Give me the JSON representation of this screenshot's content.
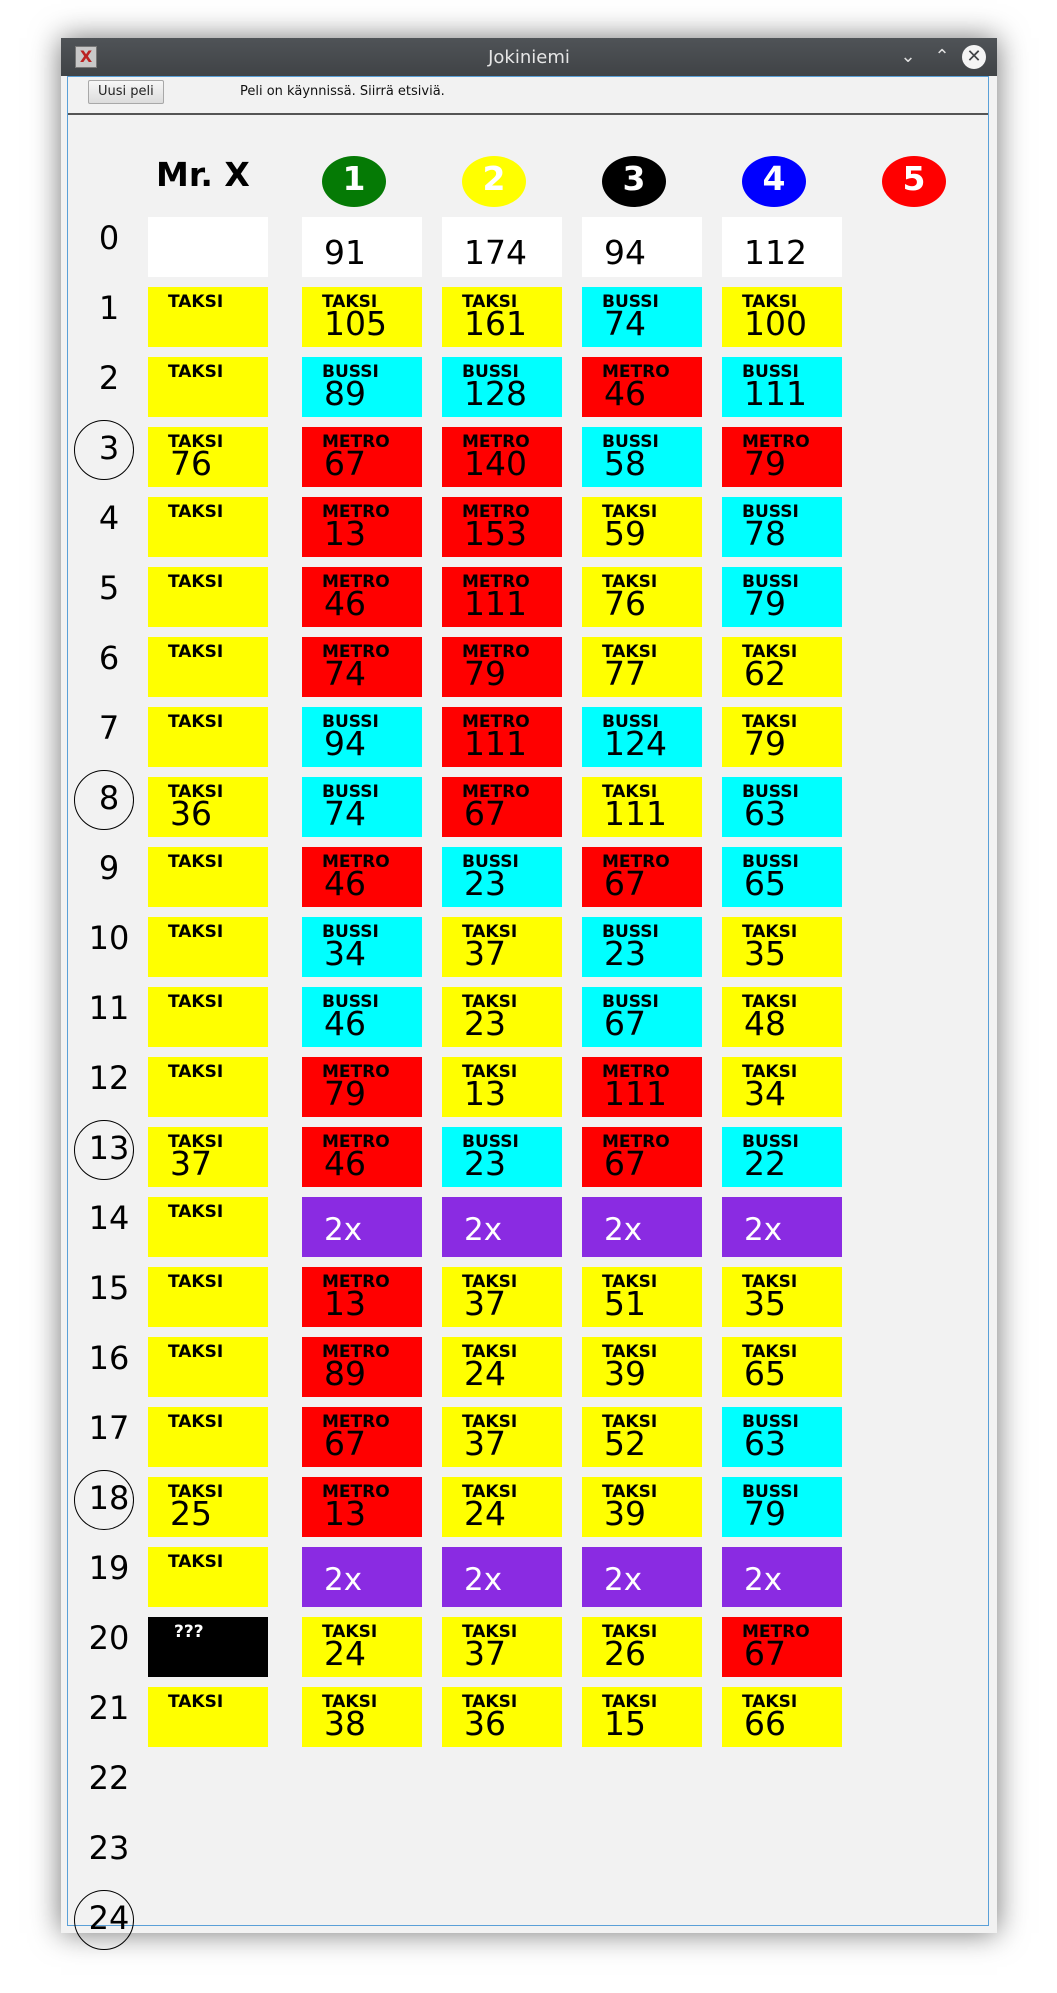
{
  "window": {
    "title": "Jokiniemi"
  },
  "toolbar": {
    "new_game_label": "Uusi peli",
    "status_text": "Peli on käynnissä. Siirrä etsiviä."
  },
  "mrx_title": "Mr. X",
  "detectives": [
    {
      "label": "1",
      "color": "#057a05"
    },
    {
      "label": "2",
      "color": "#ffff00"
    },
    {
      "label": "3",
      "color": "#000000"
    },
    {
      "label": "4",
      "color": "#0000ff"
    },
    {
      "label": "5",
      "color": "#ff0000"
    }
  ],
  "colors": {
    "TAKSI": "#ffff00",
    "BUSSI": "#00ffff",
    "METRO": "#ff0000",
    "double": "#8a2be2",
    "hidden": "#000000",
    "empty": "#ffffff"
  },
  "reveal_rounds": [
    3,
    8,
    13,
    18,
    24
  ],
  "rounds": [
    "0",
    "1",
    "2",
    "3",
    "4",
    "5",
    "6",
    "7",
    "8",
    "9",
    "10",
    "11",
    "12",
    "13",
    "14",
    "15",
    "16",
    "17",
    "18",
    "19",
    "20",
    "21",
    "22",
    "23",
    "24"
  ],
  "mrx_moves": [
    {
      "kind": "empty"
    },
    {
      "kind": "ticket",
      "ticket": "TAKSI"
    },
    {
      "kind": "ticket",
      "ticket": "TAKSI"
    },
    {
      "kind": "ticket",
      "ticket": "TAKSI",
      "loc": "76"
    },
    {
      "kind": "ticket",
      "ticket": "TAKSI"
    },
    {
      "kind": "ticket",
      "ticket": "TAKSI"
    },
    {
      "kind": "ticket",
      "ticket": "TAKSI"
    },
    {
      "kind": "ticket",
      "ticket": "TAKSI"
    },
    {
      "kind": "ticket",
      "ticket": "TAKSI",
      "loc": "36"
    },
    {
      "kind": "ticket",
      "ticket": "TAKSI"
    },
    {
      "kind": "ticket",
      "ticket": "TAKSI"
    },
    {
      "kind": "ticket",
      "ticket": "TAKSI"
    },
    {
      "kind": "ticket",
      "ticket": "TAKSI"
    },
    {
      "kind": "ticket",
      "ticket": "TAKSI",
      "loc": "37"
    },
    {
      "kind": "ticket",
      "ticket": "TAKSI"
    },
    {
      "kind": "ticket",
      "ticket": "TAKSI"
    },
    {
      "kind": "ticket",
      "ticket": "TAKSI"
    },
    {
      "kind": "ticket",
      "ticket": "TAKSI"
    },
    {
      "kind": "ticket",
      "ticket": "TAKSI",
      "loc": "25"
    },
    {
      "kind": "ticket",
      "ticket": "TAKSI"
    },
    {
      "kind": "hidden",
      "ticket": "???"
    },
    {
      "kind": "ticket",
      "ticket": "TAKSI"
    }
  ],
  "detective_moves": [
    [
      {
        "kind": "start",
        "loc": "91"
      },
      {
        "kind": "ticket",
        "ticket": "TAKSI",
        "loc": "105"
      },
      {
        "kind": "ticket",
        "ticket": "BUSSI",
        "loc": "89"
      },
      {
        "kind": "ticket",
        "ticket": "METRO",
        "loc": "67"
      },
      {
        "kind": "ticket",
        "ticket": "METRO",
        "loc": "13"
      },
      {
        "kind": "ticket",
        "ticket": "METRO",
        "loc": "46"
      },
      {
        "kind": "ticket",
        "ticket": "METRO",
        "loc": "74"
      },
      {
        "kind": "ticket",
        "ticket": "BUSSI",
        "loc": "94"
      },
      {
        "kind": "ticket",
        "ticket": "BUSSI",
        "loc": "74"
      },
      {
        "kind": "ticket",
        "ticket": "METRO",
        "loc": "46"
      },
      {
        "kind": "ticket",
        "ticket": "BUSSI",
        "loc": "34"
      },
      {
        "kind": "ticket",
        "ticket": "BUSSI",
        "loc": "46"
      },
      {
        "kind": "ticket",
        "ticket": "METRO",
        "loc": "79"
      },
      {
        "kind": "ticket",
        "ticket": "METRO",
        "loc": "46"
      },
      {
        "kind": "double",
        "text": "2x"
      },
      {
        "kind": "ticket",
        "ticket": "METRO",
        "loc": "13"
      },
      {
        "kind": "ticket",
        "ticket": "METRO",
        "loc": "89"
      },
      {
        "kind": "ticket",
        "ticket": "METRO",
        "loc": "67"
      },
      {
        "kind": "ticket",
        "ticket": "METRO",
        "loc": "13"
      },
      {
        "kind": "double",
        "text": "2x"
      },
      {
        "kind": "ticket",
        "ticket": "TAKSI",
        "loc": "24"
      },
      {
        "kind": "ticket",
        "ticket": "TAKSI",
        "loc": "38"
      }
    ],
    [
      {
        "kind": "start",
        "loc": "174"
      },
      {
        "kind": "ticket",
        "ticket": "TAKSI",
        "loc": "161"
      },
      {
        "kind": "ticket",
        "ticket": "BUSSI",
        "loc": "128"
      },
      {
        "kind": "ticket",
        "ticket": "METRO",
        "loc": "140"
      },
      {
        "kind": "ticket",
        "ticket": "METRO",
        "loc": "153"
      },
      {
        "kind": "ticket",
        "ticket": "METRO",
        "loc": "111"
      },
      {
        "kind": "ticket",
        "ticket": "METRO",
        "loc": "79"
      },
      {
        "kind": "ticket",
        "ticket": "METRO",
        "loc": "111"
      },
      {
        "kind": "ticket",
        "ticket": "METRO",
        "loc": "67"
      },
      {
        "kind": "ticket",
        "ticket": "BUSSI",
        "loc": "23"
      },
      {
        "kind": "ticket",
        "ticket": "TAKSI",
        "loc": "37"
      },
      {
        "kind": "ticket",
        "ticket": "TAKSI",
        "loc": "23"
      },
      {
        "kind": "ticket",
        "ticket": "TAKSI",
        "loc": "13"
      },
      {
        "kind": "ticket",
        "ticket": "BUSSI",
        "loc": "23"
      },
      {
        "kind": "double",
        "text": "2x"
      },
      {
        "kind": "ticket",
        "ticket": "TAKSI",
        "loc": "37"
      },
      {
        "kind": "ticket",
        "ticket": "TAKSI",
        "loc": "24"
      },
      {
        "kind": "ticket",
        "ticket": "TAKSI",
        "loc": "37"
      },
      {
        "kind": "ticket",
        "ticket": "TAKSI",
        "loc": "24"
      },
      {
        "kind": "double",
        "text": "2x"
      },
      {
        "kind": "ticket",
        "ticket": "TAKSI",
        "loc": "37"
      },
      {
        "kind": "ticket",
        "ticket": "TAKSI",
        "loc": "36"
      }
    ],
    [
      {
        "kind": "start",
        "loc": "94"
      },
      {
        "kind": "ticket",
        "ticket": "BUSSI",
        "loc": "74"
      },
      {
        "kind": "ticket",
        "ticket": "METRO",
        "loc": "46"
      },
      {
        "kind": "ticket",
        "ticket": "BUSSI",
        "loc": "58"
      },
      {
        "kind": "ticket",
        "ticket": "TAKSI",
        "loc": "59"
      },
      {
        "kind": "ticket",
        "ticket": "TAKSI",
        "loc": "76"
      },
      {
        "kind": "ticket",
        "ticket": "TAKSI",
        "loc": "77"
      },
      {
        "kind": "ticket",
        "ticket": "BUSSI",
        "loc": "124"
      },
      {
        "kind": "ticket",
        "ticket": "TAKSI",
        "loc": "111"
      },
      {
        "kind": "ticket",
        "ticket": "METRO",
        "loc": "67"
      },
      {
        "kind": "ticket",
        "ticket": "BUSSI",
        "loc": "23"
      },
      {
        "kind": "ticket",
        "ticket": "BUSSI",
        "loc": "67"
      },
      {
        "kind": "ticket",
        "ticket": "METRO",
        "loc": "111"
      },
      {
        "kind": "ticket",
        "ticket": "METRO",
        "loc": "67"
      },
      {
        "kind": "double",
        "text": "2x"
      },
      {
        "kind": "ticket",
        "ticket": "TAKSI",
        "loc": "51"
      },
      {
        "kind": "ticket",
        "ticket": "TAKSI",
        "loc": "39"
      },
      {
        "kind": "ticket",
        "ticket": "TAKSI",
        "loc": "52"
      },
      {
        "kind": "ticket",
        "ticket": "TAKSI",
        "loc": "39"
      },
      {
        "kind": "double",
        "text": "2x"
      },
      {
        "kind": "ticket",
        "ticket": "TAKSI",
        "loc": "26"
      },
      {
        "kind": "ticket",
        "ticket": "TAKSI",
        "loc": "15"
      }
    ],
    [
      {
        "kind": "start",
        "loc": "112"
      },
      {
        "kind": "ticket",
        "ticket": "TAKSI",
        "loc": "100"
      },
      {
        "kind": "ticket",
        "ticket": "BUSSI",
        "loc": "111"
      },
      {
        "kind": "ticket",
        "ticket": "METRO",
        "loc": "79"
      },
      {
        "kind": "ticket",
        "ticket": "BUSSI",
        "loc": "78"
      },
      {
        "kind": "ticket",
        "ticket": "BUSSI",
        "loc": "79"
      },
      {
        "kind": "ticket",
        "ticket": "TAKSI",
        "loc": "62"
      },
      {
        "kind": "ticket",
        "ticket": "TAKSI",
        "loc": "79"
      },
      {
        "kind": "ticket",
        "ticket": "BUSSI",
        "loc": "63"
      },
      {
        "kind": "ticket",
        "ticket": "BUSSI",
        "loc": "65"
      },
      {
        "kind": "ticket",
        "ticket": "TAKSI",
        "loc": "35"
      },
      {
        "kind": "ticket",
        "ticket": "TAKSI",
        "loc": "48"
      },
      {
        "kind": "ticket",
        "ticket": "TAKSI",
        "loc": "34"
      },
      {
        "kind": "ticket",
        "ticket": "BUSSI",
        "loc": "22"
      },
      {
        "kind": "double",
        "text": "2x"
      },
      {
        "kind": "ticket",
        "ticket": "TAKSI",
        "loc": "35"
      },
      {
        "kind": "ticket",
        "ticket": "TAKSI",
        "loc": "65"
      },
      {
        "kind": "ticket",
        "ticket": "BUSSI",
        "loc": "63"
      },
      {
        "kind": "ticket",
        "ticket": "BUSSI",
        "loc": "79"
      },
      {
        "kind": "double",
        "text": "2x"
      },
      {
        "kind": "ticket",
        "ticket": "METRO",
        "loc": "67"
      },
      {
        "kind": "ticket",
        "ticket": "TAKSI",
        "loc": "66"
      }
    ],
    []
  ]
}
